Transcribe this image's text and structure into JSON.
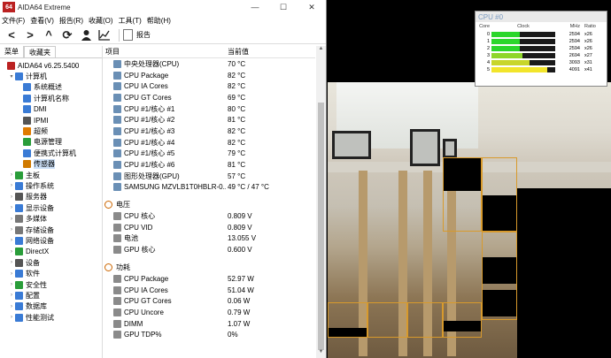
{
  "titlebar": {
    "title": "AIDA64 Extreme",
    "app_icon": "64",
    "minimize": "—",
    "maximize": "☐",
    "close": "✕"
  },
  "menu": [
    "文件(F)",
    "查看(V)",
    "报告(R)",
    "收藏(O)",
    "工具(T)",
    "帮助(H)"
  ],
  "toolbar": {
    "report_label": "报告"
  },
  "tabs": [
    "菜单",
    "收藏夹"
  ],
  "tree": [
    {
      "label": "AIDA64 v6.25.5400",
      "indent": 0,
      "twisty": "",
      "color": "#b22"
    },
    {
      "label": "计算机",
      "indent": 1,
      "twisty": "▾",
      "color": "#3a7bd5"
    },
    {
      "label": "系统概述",
      "indent": 2,
      "twisty": "",
      "color": "#3a7bd5"
    },
    {
      "label": "计算机名称",
      "indent": 2,
      "twisty": "",
      "color": "#3a7bd5"
    },
    {
      "label": "DMI",
      "indent": 2,
      "twisty": "",
      "color": "#3a7bd5"
    },
    {
      "label": "IPMI",
      "indent": 2,
      "twisty": "",
      "color": "#555"
    },
    {
      "label": "超频",
      "indent": 2,
      "twisty": "",
      "color": "#e07b00"
    },
    {
      "label": "电源管理",
      "indent": 2,
      "twisty": "",
      "color": "#2a9d3a"
    },
    {
      "label": "便携式计算机",
      "indent": 2,
      "twisty": "",
      "color": "#3a7bd5"
    },
    {
      "label": "传感器",
      "indent": 2,
      "twisty": "",
      "color": "#d07a00",
      "selected": true
    },
    {
      "label": "主板",
      "indent": 1,
      "twisty": "›",
      "color": "#2a9d3a"
    },
    {
      "label": "操作系统",
      "indent": 1,
      "twisty": "›",
      "color": "#3a7bd5"
    },
    {
      "label": "服务器",
      "indent": 1,
      "twisty": "›",
      "color": "#555"
    },
    {
      "label": "显示设备",
      "indent": 1,
      "twisty": "›",
      "color": "#3a7bd5"
    },
    {
      "label": "多媒体",
      "indent": 1,
      "twisty": "›",
      "color": "#777"
    },
    {
      "label": "存储设备",
      "indent": 1,
      "twisty": "›",
      "color": "#777"
    },
    {
      "label": "网络设备",
      "indent": 1,
      "twisty": "›",
      "color": "#3a7bd5"
    },
    {
      "label": "DirectX",
      "indent": 1,
      "twisty": "›",
      "color": "#2a9d3a"
    },
    {
      "label": "设备",
      "indent": 1,
      "twisty": "›",
      "color": "#555"
    },
    {
      "label": "软件",
      "indent": 1,
      "twisty": "›",
      "color": "#3a7bd5"
    },
    {
      "label": "安全性",
      "indent": 1,
      "twisty": "›",
      "color": "#2a9d3a"
    },
    {
      "label": "配置",
      "indent": 1,
      "twisty": "›",
      "color": "#3a7bd5"
    },
    {
      "label": "数据库",
      "indent": 1,
      "twisty": "›",
      "color": "#3a7bd5"
    },
    {
      "label": "性能测试",
      "indent": 1,
      "twisty": "›",
      "color": "#3a7bd5"
    }
  ],
  "table": {
    "col_item": "项目",
    "col_value": "当前值",
    "top_rows": [
      {
        "item": "中央处理器(CPU)",
        "value": "70 °C"
      },
      {
        "item": "CPU Package",
        "value": "82 °C"
      },
      {
        "item": "CPU IA Cores",
        "value": "82 °C"
      },
      {
        "item": "CPU GT Cores",
        "value": "69 °C"
      },
      {
        "item": "CPU #1/核心 #1",
        "value": "80 °C"
      },
      {
        "item": "CPU #1/核心 #2",
        "value": "81 °C"
      },
      {
        "item": "CPU #1/核心 #3",
        "value": "82 °C"
      },
      {
        "item": "CPU #1/核心 #4",
        "value": "82 °C"
      },
      {
        "item": "CPU #1/核心 #5",
        "value": "79 °C"
      },
      {
        "item": "CPU #1/核心 #6",
        "value": "81 °C"
      },
      {
        "item": "图形处理器(GPU)",
        "value": "57 °C"
      },
      {
        "item": "SAMSUNG MZVLB1T0HBLR-0...",
        "value": "49 °C / 47 °C"
      }
    ],
    "sections": [
      {
        "title": "电压",
        "rows": [
          {
            "item": "CPU 核心",
            "value": "0.809 V"
          },
          {
            "item": "CPU VID",
            "value": "0.809 V"
          },
          {
            "item": "电池",
            "value": "13.055 V"
          },
          {
            "item": "GPU 核心",
            "value": "0.600 V"
          }
        ]
      },
      {
        "title": "功耗",
        "rows": [
          {
            "item": "CPU Package",
            "value": "52.97 W"
          },
          {
            "item": "CPU IA Cores",
            "value": "51.04 W"
          },
          {
            "item": "CPU GT Cores",
            "value": "0.06 W"
          },
          {
            "item": "CPU Uncore",
            "value": "0.79 W"
          },
          {
            "item": "DIMM",
            "value": "1.07 W"
          },
          {
            "item": "GPU TDP%",
            "value": "0%"
          }
        ]
      }
    ]
  },
  "cpu_widget": {
    "title": "CPU #0",
    "headers": [
      "Core",
      "Clock",
      "MHz",
      "Ratio"
    ],
    "cores": [
      {
        "core": "0",
        "mhz": "2594",
        "ratio": "x26",
        "load": 0.45,
        "color": "#2bd62b"
      },
      {
        "core": "1",
        "mhz": "2594",
        "ratio": "x26",
        "load": 0.45,
        "color": "#2bd62b"
      },
      {
        "core": "2",
        "mhz": "2594",
        "ratio": "x26",
        "load": 0.45,
        "color": "#2bd62b"
      },
      {
        "core": "3",
        "mhz": "2694",
        "ratio": "x27",
        "load": 0.48,
        "color": "#8fd62b"
      },
      {
        "core": "4",
        "mhz": "3093",
        "ratio": "x31",
        "load": 0.6,
        "color": "#c8d62b"
      },
      {
        "core": "5",
        "mhz": "4091",
        "ratio": "x41",
        "load": 0.88,
        "color": "#f2e52b"
      }
    ]
  }
}
